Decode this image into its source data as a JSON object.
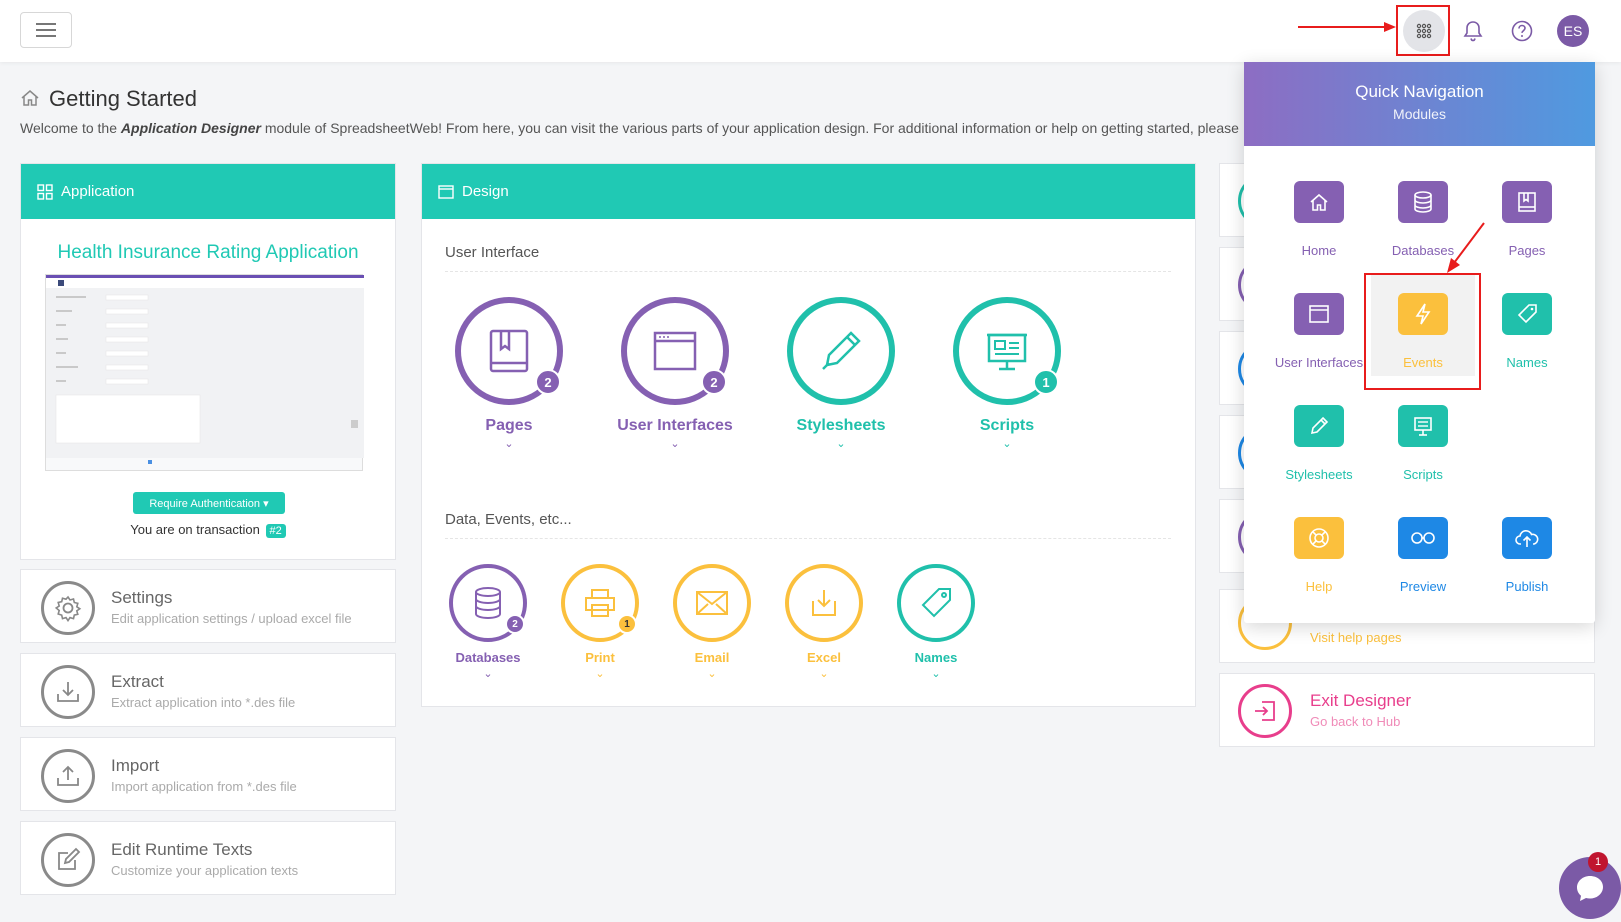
{
  "page": {
    "title": "Getting Started",
    "desc_prefix": "Welcome to the ",
    "desc_em": "Application Designer",
    "desc_suffix": " module of SpreadsheetWeb! From here, you can visit the various parts of your application design. For additional information or help on getting started, please"
  },
  "topbar": {
    "avatar_initials": "ES"
  },
  "application_card": {
    "header": "Application",
    "app_name": "Health Insurance Rating Application",
    "auth_button": "Require Authentication ▾",
    "transaction_text": "You are on transaction",
    "transaction_badge": "#2"
  },
  "left_list": [
    {
      "title": "Settings",
      "subtitle": "Edit application settings / upload excel file"
    },
    {
      "title": "Extract",
      "subtitle": "Extract application into *.des file"
    },
    {
      "title": "Import",
      "subtitle": "Import application from *.des file"
    },
    {
      "title": "Edit Runtime Texts",
      "subtitle": "Customize your application texts"
    }
  ],
  "design_card": {
    "header": "Design",
    "section_ui": "User Interface",
    "section_data": "Data, Events, etc...",
    "ui_items": [
      {
        "label": "Pages",
        "badge": "2",
        "color": "#8560b2"
      },
      {
        "label": "User Interfaces",
        "badge": "2",
        "color": "#8560b2"
      },
      {
        "label": "Stylesheets",
        "badge": "",
        "color": "#20c0ab"
      },
      {
        "label": "Scripts",
        "badge": "1",
        "color": "#20c0ab"
      }
    ],
    "data_items": [
      {
        "label": "Databases",
        "badge": "2",
        "color": "#8560b2"
      },
      {
        "label": "Print",
        "badge": "1",
        "color": "#fbc03d"
      },
      {
        "label": "Email",
        "badge": "",
        "color": "#fbc03d"
      },
      {
        "label": "Excel",
        "badge": "",
        "color": "#fbc03d"
      },
      {
        "label": "Names",
        "badge": "",
        "color": "#20c0ab"
      }
    ]
  },
  "right_list": {
    "help_subtitle": "Visit help pages",
    "exit_title": "Exit Designer",
    "exit_subtitle": "Go back to Hub"
  },
  "quick_nav": {
    "title": "Quick Navigation",
    "subtitle": "Modules",
    "items": [
      {
        "label": "Home",
        "icon": "home-icon",
        "color": "#8560b2"
      },
      {
        "label": "Databases",
        "icon": "database-icon",
        "color": "#8560b2"
      },
      {
        "label": "Pages",
        "icon": "book-icon",
        "color": "#8560b2"
      },
      {
        "label": "User Interfaces",
        "icon": "window-icon",
        "color": "#8560b2"
      },
      {
        "label": "Events",
        "icon": "bolt-icon",
        "color": "#fbc03d"
      },
      {
        "label": "Names",
        "icon": "tag-icon",
        "color": "#20c0ab"
      },
      {
        "label": "Stylesheets",
        "icon": "pen-icon",
        "color": "#20c0ab"
      },
      {
        "label": "Scripts",
        "icon": "presentation-icon",
        "color": "#20c0ab"
      },
      {
        "label": "Help",
        "icon": "lifebuoy-icon",
        "color": "#fbc03d"
      },
      {
        "label": "Preview",
        "icon": "glasses-icon",
        "color": "#1e88e5"
      },
      {
        "label": "Publish",
        "icon": "cloud-upload-icon",
        "color": "#1e88e5"
      }
    ]
  },
  "chat": {
    "badge": "1"
  },
  "colors": {
    "teal": "#20c9b4",
    "purple": "#8560b2",
    "yellow": "#fbc03d",
    "blue": "#1e88e5",
    "pink": "#e83e8c",
    "annotation_red": "#e81c1c"
  }
}
